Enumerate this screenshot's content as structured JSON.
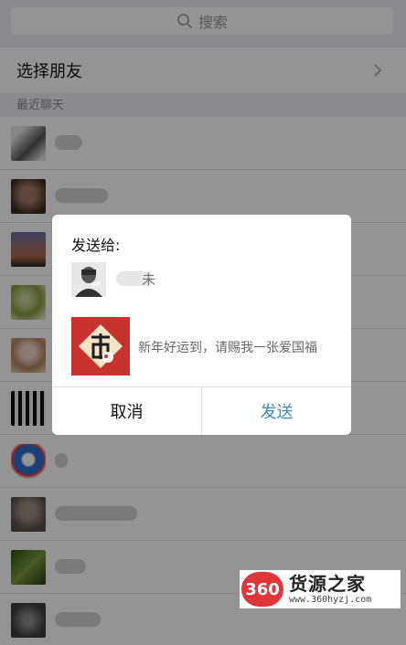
{
  "search": {
    "placeholder": "搜索"
  },
  "select_friends": {
    "label": "选择朋友"
  },
  "recent": {
    "header": "最近聊天"
  },
  "chats": [
    {
      "avatar": "person-portrait"
    },
    {
      "avatar": "person-face"
    },
    {
      "avatar": "sunset-sky"
    },
    {
      "avatar": "tree-branch"
    },
    {
      "avatar": "girl-portrait"
    },
    {
      "avatar": "silhouettes"
    },
    {
      "avatar": "doraemon"
    },
    {
      "avatar": "person-blur"
    },
    {
      "avatar": "green-leaves"
    },
    {
      "avatar": "blurred-photo"
    }
  ],
  "dialog": {
    "title": "发送给:",
    "recipient_suffix": "未",
    "card_text": "新年好运到，请赐我一张爱国福",
    "cancel_label": "取消",
    "send_label": "发送"
  },
  "watermark": {
    "logo_text": "360",
    "title": "货源之家",
    "url": "www.360hyzj.com"
  },
  "colors": {
    "send_blue": "#3d8ac9",
    "overlay": "rgba(0,0,0,0.42)",
    "card_red": "#c8332f"
  }
}
